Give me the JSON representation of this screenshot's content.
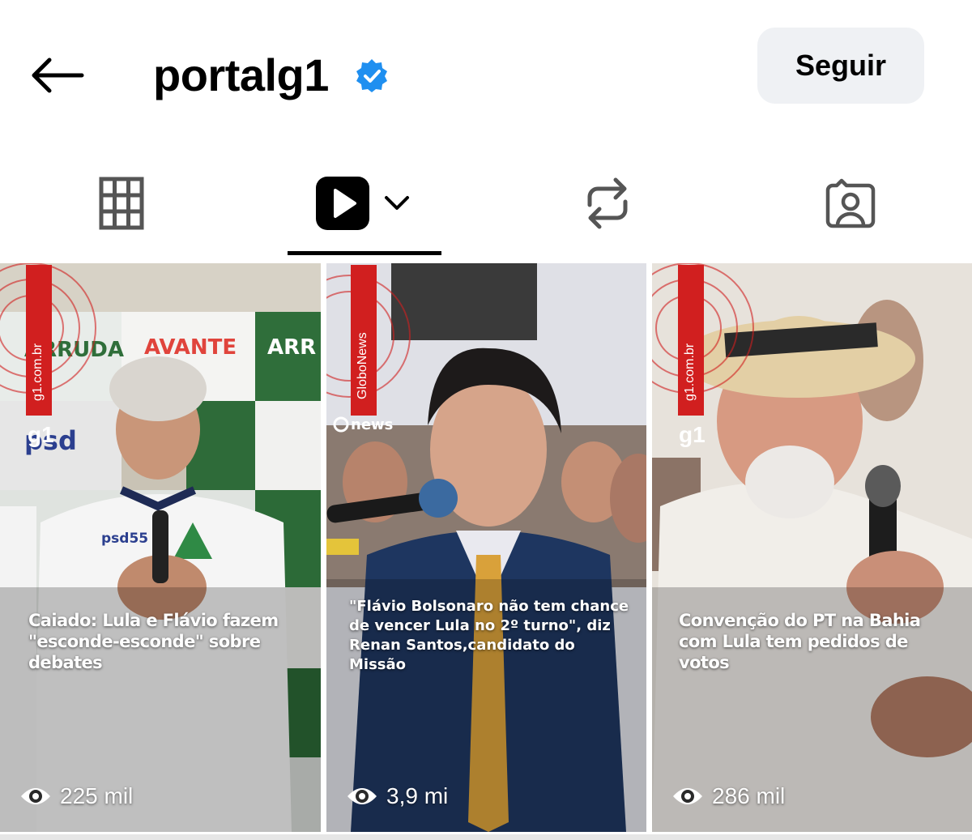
{
  "profile": {
    "username": "portalg1",
    "follow_label": "Seguir",
    "verified": true
  },
  "icons": {
    "back": "arrow-left-icon",
    "verified": "verified-badge-icon",
    "grid": "grid-icon",
    "reels": "reels-play-icon",
    "dropdown": "chevron-down-icon",
    "reposts": "repost-icon",
    "tagged": "tagged-person-icon",
    "views": "eye-icon"
  },
  "colors": {
    "accent_blue": "#1f8ff0",
    "follow_bg": "#eff1f4",
    "g1_red": "#d11f1f"
  },
  "reels": [
    {
      "caption": "Caiado: Lula e Flávio fazem \"esconde-esconde\" sobre debates",
      "views": "225 mil",
      "source_vertical": "g1.com.br",
      "logo": "g1"
    },
    {
      "caption": "\"Flávio Bolsonaro não tem chance de vencer Lula no 2º turno\", diz Renan Santos,candidato do Missão",
      "views": "3,9 mi",
      "source_vertical": "GloboNews",
      "logo": "news"
    },
    {
      "caption": "Convenção do PT na Bahia com Lula tem pedidos de votos",
      "views": "286 mil",
      "source_vertical": "g1.com.br",
      "logo": "g1"
    }
  ]
}
